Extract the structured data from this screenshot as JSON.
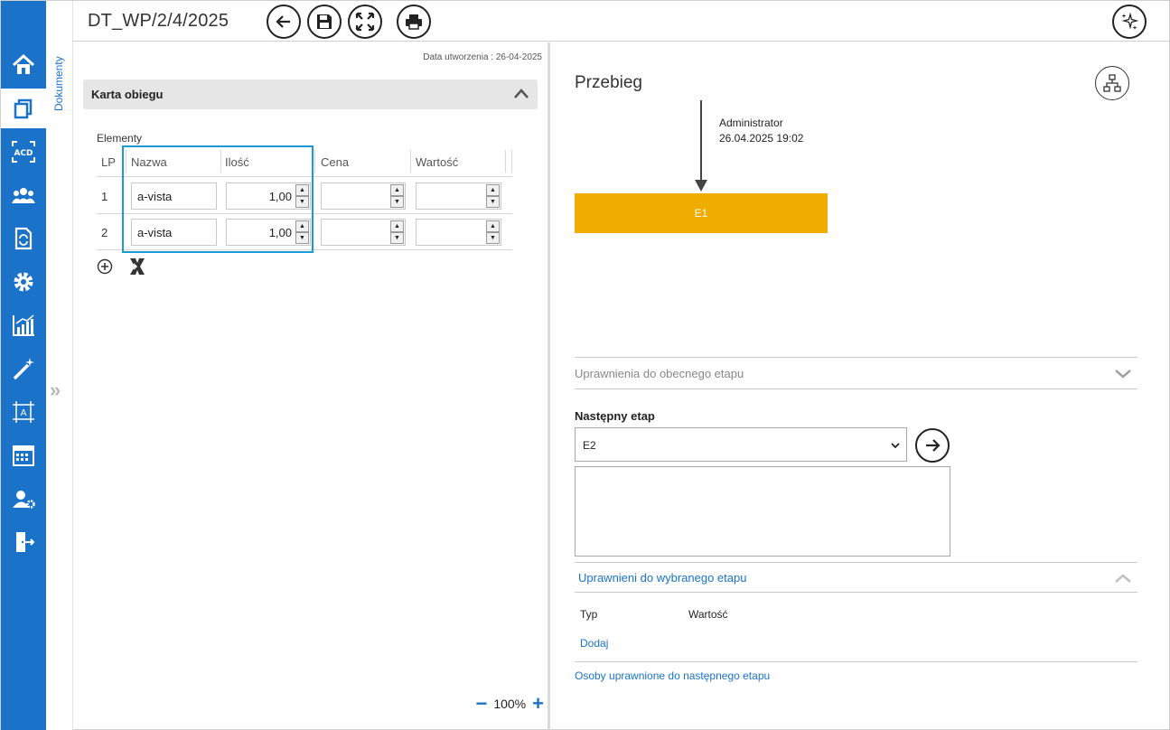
{
  "header": {
    "doc_title": "DT_WP/2/4/2025",
    "toolbar_icons": [
      "back-arrow-icon",
      "save-icon",
      "fullscreen-icon",
      "print-icon",
      "sparkles-icon"
    ]
  },
  "nav": {
    "items": [
      "home-icon",
      "documents-icon",
      "ocr-icon",
      "users-icon",
      "document-sync-icon",
      "gear-icon",
      "chart-icon",
      "magic-wand-icon",
      "template-icon",
      "calendar-icon",
      "user-settings-icon",
      "exit-icon"
    ],
    "active": "documents-icon"
  },
  "sidestrip": {
    "label": "Dokumenty"
  },
  "left": {
    "created": "Data utworzenia : 26-04-2025",
    "card_title": "Karta obiegu",
    "elements_label": "Elementy",
    "columns": {
      "lp": "LP",
      "nazwa": "Nazwa",
      "ilosc": "Ilość",
      "cena": "Cena",
      "wartosc": "Wartość"
    },
    "rows": [
      {
        "lp": "1",
        "nazwa": "a-vista",
        "ilosc": "1,00",
        "cena": "",
        "wartosc": ""
      },
      {
        "lp": "2",
        "nazwa": "a-vista",
        "ilosc": "1,00",
        "cena": "",
        "wartosc": ""
      }
    ],
    "zoom": "100%"
  },
  "right": {
    "title": "Przebieg",
    "admin_name": "Administrator",
    "admin_date": "26.04.2025 19:02",
    "stage_label": "E1",
    "section_current": "Uprawnienia do obecnego etapu",
    "next_stage_label": "Następny etap",
    "next_stage_value": "E2",
    "section_chosen": "Uprawnieni do wybranego etapu",
    "col_typ": "Typ",
    "col_wartosc": "Wartość",
    "add_link": "Dodaj",
    "people_link": "Osoby uprawnione do następnego etapu"
  },
  "colors": {
    "accent": "#1a73c9",
    "stage": "#f0ad00",
    "highlight": "#1a9ad6"
  }
}
